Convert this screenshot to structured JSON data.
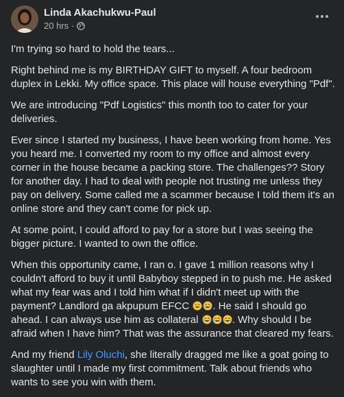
{
  "post": {
    "author": "Linda Akachukwu-Paul",
    "timestamp": "20 hrs",
    "separator": "·",
    "privacy_icon": "globe-icon",
    "more_icon": "more-options-icon",
    "paragraphs": {
      "p1": "I'm trying so hard to hold the tears...",
      "p2": "Right behind me is my BIRTHDAY GIFT to myself. A four bedroom duplex in Lekki. My office space. This place will house everything \"Pdf\".",
      "p3": "We are introducing \"Pdf Logistics\" this month too to cater for your deliveries.",
      "p4": "Ever since I started my business, I have been working from home. Yes you heard me. I converted my room to my office and almost every corner in the house became a packing store. The challenges?? Story for another day. I had to deal with people not trusting me unless they pay on delivery. Some called me a scammer because I told them it's an online store and they can't come for pick up.",
      "p5": "At some point, I could afford to pay for a store but I was seeing the bigger picture. I wanted to own the office.",
      "p6a": "When this opportunity came, I ran o. I gave 1 million reasons why I couldn't afford to buy it until Babyboy stepped in to push me. He asked what my fear was and I told him what if I didn't meet up with the payment? Landlord ga akpupum EFCC ",
      "p6b": ". He said I should go ahead. I can always use him as collateral ",
      "p6c": ". Why should I be afraid when I have him? That was the assurance that cleared my fears.",
      "p7_link": "Lily Oluchi",
      "p7a": "And my friend ",
      "p7b": ", she literally dragged me like a goat going to slaughter until I made my first commitment. Talk about friends who wants to see you win with them."
    }
  }
}
